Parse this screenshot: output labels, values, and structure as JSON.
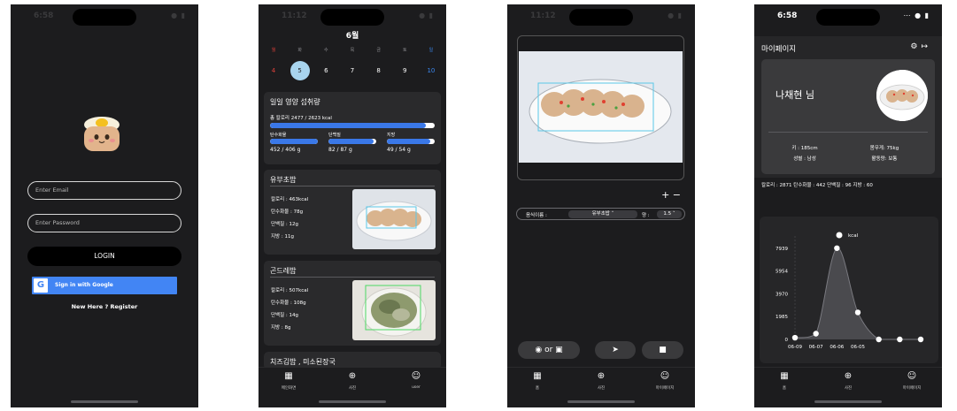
{
  "screen_login": {
    "time": "6:58",
    "email_placeholder": "Enter Email",
    "password_placeholder": "Enter Password",
    "login_label": "LOGIN",
    "google_label": "Sign in with Google",
    "register_label": "New Here ? Register"
  },
  "screen_calendar": {
    "time": "11:12",
    "month": "6월",
    "weekdays": [
      "월",
      "화",
      "수",
      "목",
      "금",
      "토",
      "일"
    ],
    "dates": [
      "4",
      "5",
      "6",
      "7",
      "8",
      "9",
      "10"
    ],
    "selected_date": "5",
    "intake": {
      "title": "일일 영양 섭취량",
      "total_label": "총 칼로리 2477 / 2623 kcal",
      "total_fraction": 0.944,
      "carb_label": "탄수화물",
      "carb_value": "452 / 406 g",
      "carb_fraction": 1.0,
      "protein_label": "단백질",
      "protein_value": "82 / 87 g",
      "protein_fraction": 0.943,
      "fat_label": "지방",
      "fat_value": "49 / 54 g",
      "fat_fraction": 0.907
    },
    "meals": [
      {
        "name": "유부초밥",
        "calorie": "칼로리 : 463kcal",
        "carb": "탄수화물 : 78g",
        "protein": "단백질 : 12g",
        "fat": "지방 : 11g"
      },
      {
        "name": "곤드레밥",
        "calorie": "칼로리 : 507kcal",
        "carb": "탄수화물 : 108g",
        "protein": "단백질 : 14g",
        "fat": "지방 : 8g"
      },
      {
        "name": "치즈김밥 , 미소된장국"
      }
    ],
    "tabs": [
      "메인화면",
      "사진",
      "user"
    ]
  },
  "screen_photo": {
    "time": "11:12",
    "plus_minus": "+ −",
    "food_label": "음식이름 :",
    "food_value": "유부초밥",
    "qty_label": "양 :",
    "qty_value": "1.5",
    "camera_or": "or",
    "tabs": [
      "홈",
      "사진",
      "마이페이지"
    ]
  },
  "screen_mypage": {
    "time": "6:58",
    "title": "마이페이지",
    "user_name": "나채현 님",
    "height": "키 : 185cm",
    "weight": "몸무게: 75kg",
    "sex": "성별 : 남성",
    "activity": "활동량: 보통",
    "summary": "칼로리 : 2871   탄수화물 : 442   단백질 : 96   지방 : 60",
    "tabs": [
      "홈",
      "사진",
      "마이페이지"
    ]
  },
  "chart_data": {
    "type": "area",
    "title": "",
    "series": [
      {
        "name": "kcal",
        "values": [
          150,
          500,
          7939,
          2350,
          0,
          0,
          0
        ]
      }
    ],
    "x": [
      "06-09",
      "06-07",
      "06-06",
      "06-05",
      "",
      "",
      ""
    ],
    "yticks": [
      0,
      1985,
      3970,
      5954,
      7939
    ],
    "ylim": [
      0,
      9000
    ],
    "xlabel": "",
    "ylabel": "",
    "legend": "top-center",
    "grid": false
  },
  "colors": {
    "background": "#1c1c1e",
    "card": "#2a2a2c",
    "accent_blue": "#3a78e8",
    "google_blue": "#4285f4",
    "selected_date": "#a8d4ee",
    "sunday": "#e0403a",
    "saturday": "#3a88f0"
  }
}
